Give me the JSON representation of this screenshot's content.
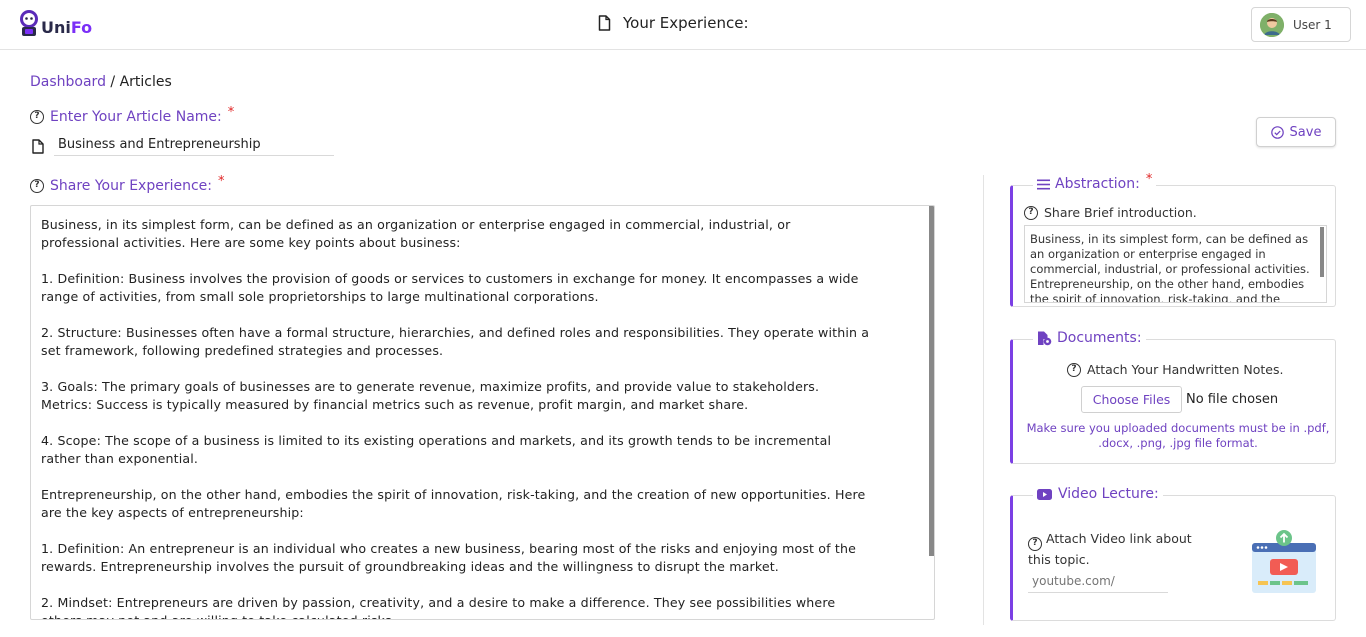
{
  "app": {
    "logo_uni": "Uni",
    "logo_fo": "Fo",
    "page_title": "Your Experience:",
    "user_name": "User 1"
  },
  "breadcrumb": {
    "link": "Dashboard",
    "separator": " / ",
    "current": "Articles"
  },
  "article": {
    "name_label": "Enter Your Article Name:",
    "name_value": "Business and Entrepreneurship",
    "required_mark": "*"
  },
  "toolbar": {
    "save_label": "Save"
  },
  "experience": {
    "label": "Share Your Experience:",
    "required_mark": "*",
    "text": "Business, in its simplest form, can be defined as an organization or enterprise engaged in commercial, industrial, or\nprofessional activities. Here are some key points about business:\n\n1. Definition: Business involves the provision of goods or services to customers in exchange for money. It encompasses a wide\nrange of activities, from small sole proprietorships to large multinational corporations.\n\n2. Structure: Businesses often have a formal structure, hierarchies, and defined roles and responsibilities. They operate within a\nset framework, following predefined strategies and processes.\n\n3. Goals: The primary goals of businesses are to generate revenue, maximize profits, and provide value to stakeholders.\nMetrics: Success is typically measured by financial metrics such as revenue, profit margin, and market share.\n\n4. Scope: The scope of a business is limited to its existing operations and markets, and its growth tends to be incremental\nrather than exponential.\n\nEntrepreneurship, on the other hand, embodies the spirit of innovation, risk-taking, and the creation of new opportunities. Here\nare the key aspects of entrepreneurship:\n\n1. Definition: An entrepreneur is an individual who creates a new business, bearing most of the risks and enjoying most of the\nrewards. Entrepreneurship involves the pursuit of groundbreaking ideas and the willingness to disrupt the market.\n\n2. Mindset: Entrepreneurs are driven by passion, creativity, and a desire to make a difference. They see possibilities where\nothers may not and are willing to take calculated risks."
  },
  "abstraction": {
    "title": "Abstraction:",
    "required_mark": "*",
    "hint": "Share Brief introduction.",
    "text": "Business, in its simplest form, can be defined as an organization or enterprise engaged in commercial, industrial, or professional activities. Entrepreneurship, on the other hand, embodies the spirit of innovation, risk-taking, and the creation of new opportunities."
  },
  "documents": {
    "title": "Documents:",
    "hint": "Attach Your Handwritten Notes.",
    "choose_label": "Choose Files",
    "file_status": "No file chosen",
    "note": "Make sure you uploaded documents must be in .pdf, .docx, .png, .jpg file format."
  },
  "video": {
    "title": "Video Lecture:",
    "hint": "Attach Video link about this topic.",
    "placeholder": "youtube.com/"
  },
  "colors": {
    "accent": "#6f42c1",
    "card_border_accent": "#7b3fe4",
    "required": "#e02424"
  },
  "icons": {
    "logo": "unifo-logo-icon",
    "page_title": "document-icon",
    "help": "question-circle-icon",
    "save": "check-circle-icon",
    "abstraction": "list-lines-icon",
    "documents": "file-settings-icon",
    "video": "youtube-icon"
  }
}
